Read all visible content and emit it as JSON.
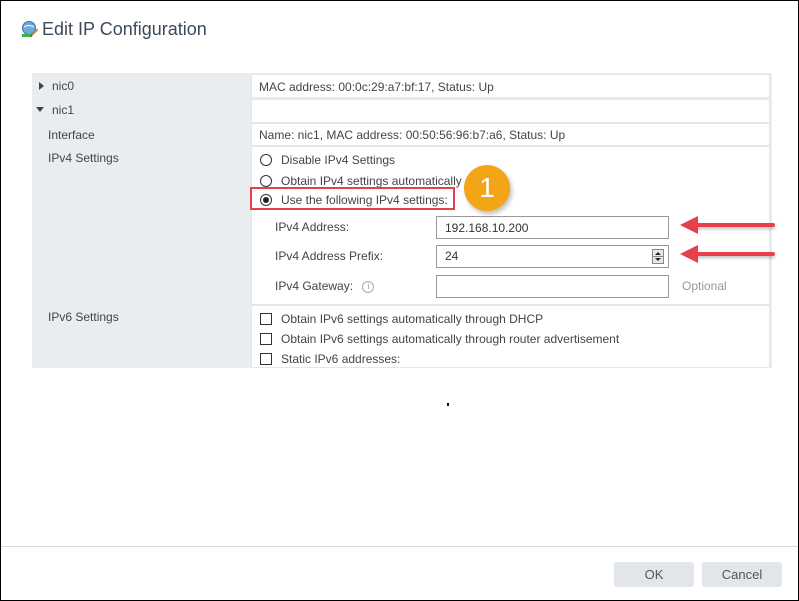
{
  "dialog": {
    "title": "Edit IP Configuration",
    "icon": "network-edit-icon"
  },
  "tree": {
    "nic0": {
      "label": "nic0",
      "expanded": false,
      "info": "MAC address: 00:0c:29:a7:bf:17, Status: Up"
    },
    "nic1": {
      "label": "nic1",
      "expanded": true,
      "info": ""
    },
    "interface": {
      "label": "Interface",
      "value": "Name: nic1, MAC address: 00:50:56:96:b7:a6, Status: Up"
    },
    "ipv4": {
      "label": "IPv4 Settings",
      "options": [
        {
          "label": "Disable IPv4 Settings",
          "selected": false
        },
        {
          "label": "Obtain IPv4 settings automatically",
          "selected": false
        },
        {
          "label": "Use the following IPv4 settings:",
          "selected": true
        }
      ],
      "fields": {
        "address": {
          "label": "IPv4 Address:",
          "value": "192.168.10.200"
        },
        "prefix": {
          "label": "IPv4 Address Prefix:",
          "value": "24"
        },
        "gateway": {
          "label": "IPv4 Gateway:",
          "value": "",
          "hint": "Optional",
          "info_icon": "i"
        }
      }
    },
    "ipv6": {
      "label": "IPv6 Settings",
      "options": [
        {
          "label": "Obtain IPv6 settings automatically through DHCP",
          "checked": false
        },
        {
          "label": "Obtain IPv6 settings automatically through router advertisement",
          "checked": false
        },
        {
          "label": "Static IPv6 addresses:",
          "checked": false
        }
      ]
    }
  },
  "annotations": {
    "step_badge": "1",
    "highlight_color": "#e8404a",
    "badge_color": "#f2a516"
  },
  "footer": {
    "ok_label": "OK",
    "cancel_label": "Cancel"
  }
}
